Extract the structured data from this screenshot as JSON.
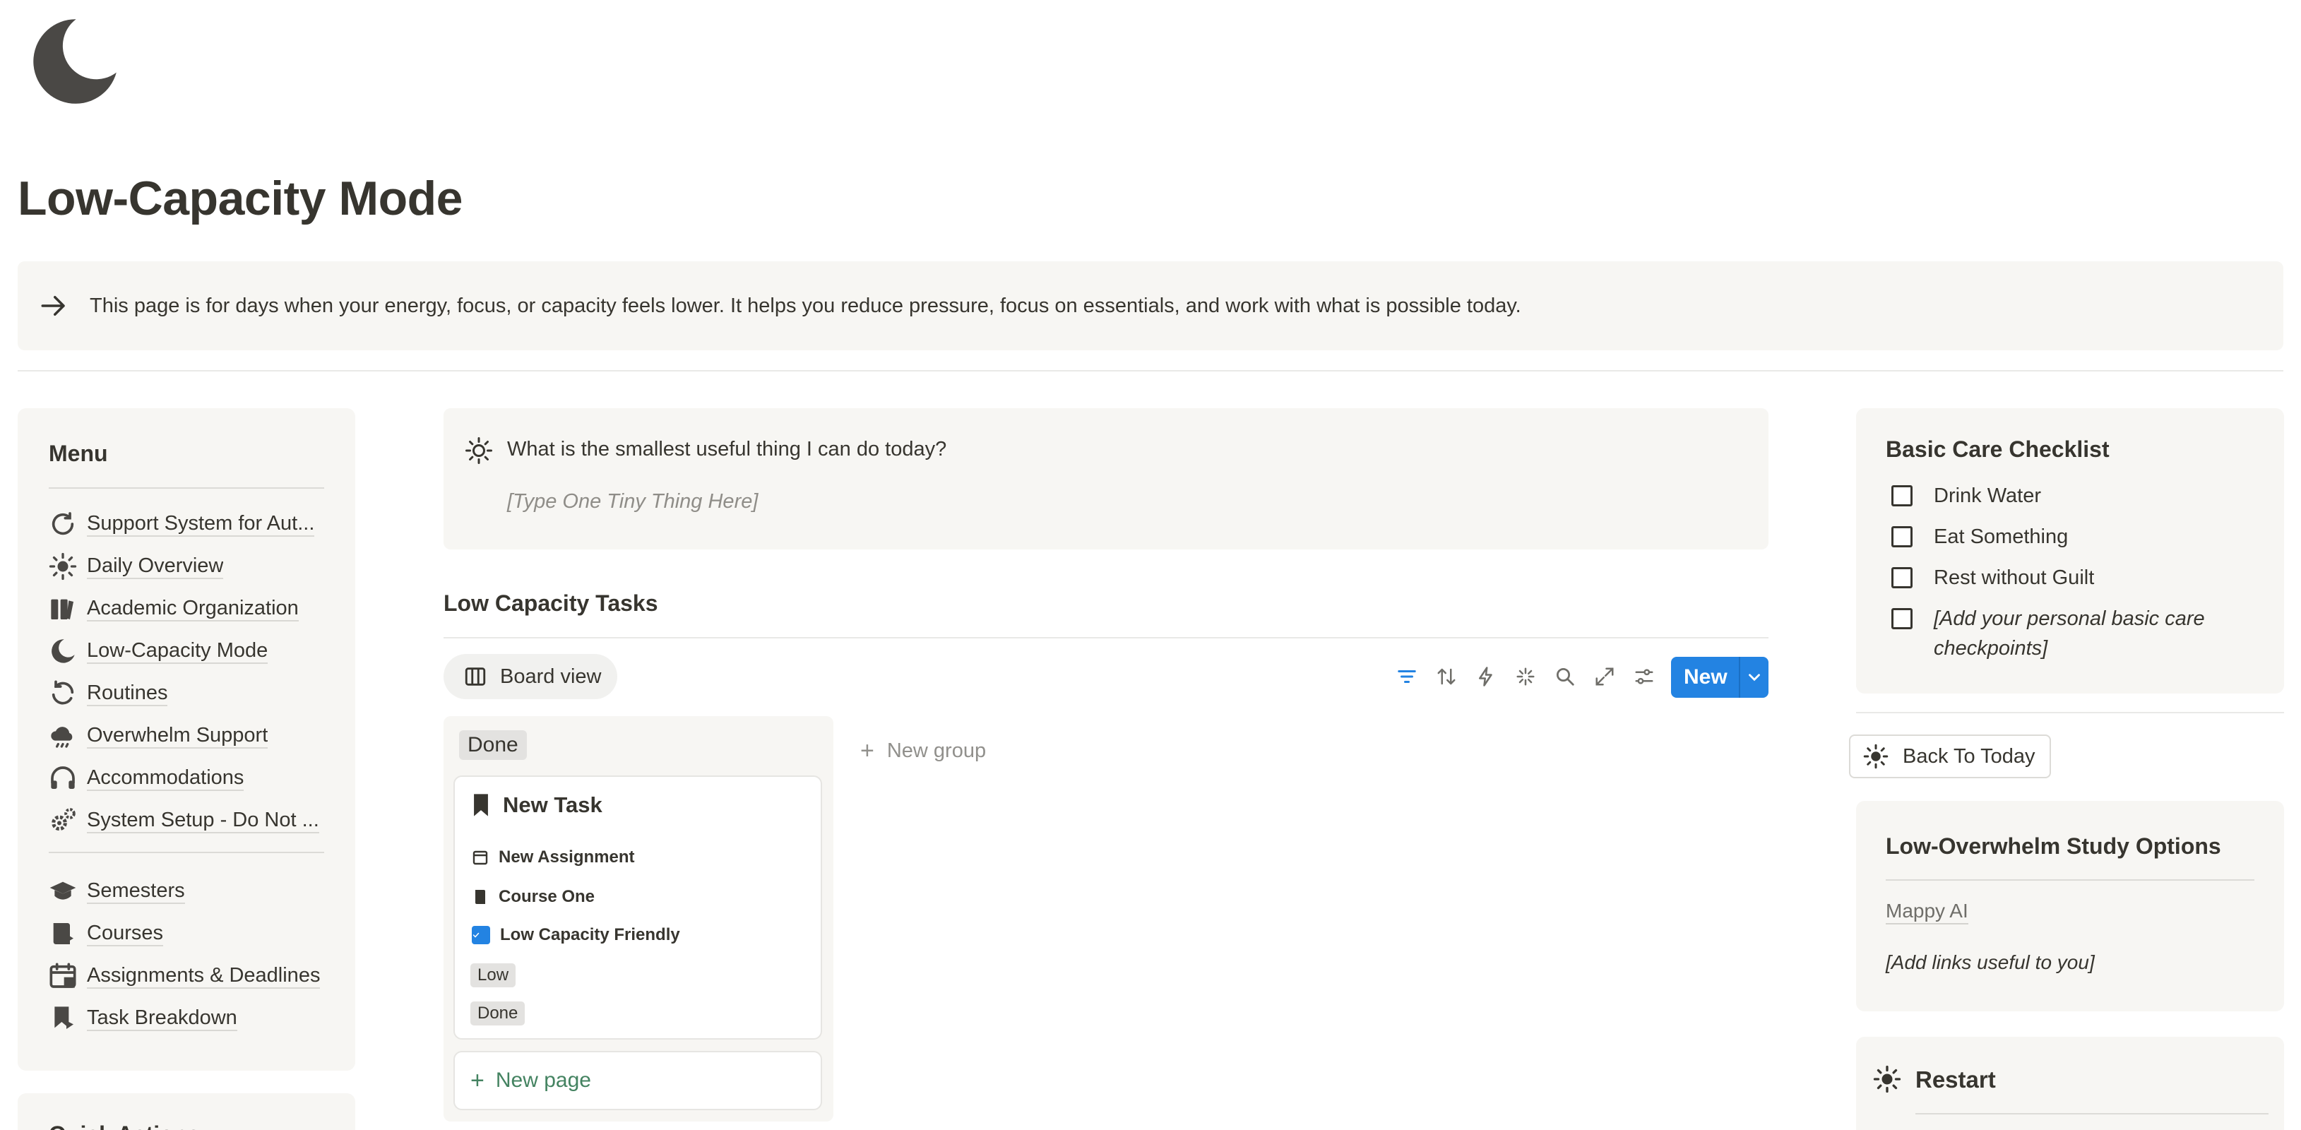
{
  "page": {
    "icon": "crescent-moon-icon",
    "title": "Low-Capacity Mode",
    "callout_icon": "arrow-right-icon",
    "callout_text": "This page is for days when your energy, focus, or capacity feels lower. It helps you reduce pressure, focus on essentials, and work with what is possible today."
  },
  "menu": {
    "title": "Menu",
    "items": [
      {
        "label": "Support System for Aut...",
        "icon": "refresh-icon"
      },
      {
        "label": "Daily Overview",
        "icon": "sun-icon"
      },
      {
        "label": "Academic Organization",
        "icon": "books-icon"
      },
      {
        "label": "Low-Capacity Mode",
        "icon": "moon-icon"
      },
      {
        "label": "Routines",
        "icon": "repeat-icon"
      },
      {
        "label": "Overwhelm Support",
        "icon": "cloud-rain-icon"
      },
      {
        "label": "Accommodations",
        "icon": "headphones-icon"
      },
      {
        "label": "System Setup - Do Not ...",
        "icon": "gears-icon"
      }
    ],
    "items2": [
      {
        "label": "Semesters",
        "icon": "graduation-cap-icon"
      },
      {
        "label": "Courses",
        "icon": "book-icon"
      },
      {
        "label": "Assignments & Deadlines",
        "icon": "calendar-icon"
      },
      {
        "label": "Task Breakdown",
        "icon": "bookmark-icon"
      }
    ],
    "next_card_title": "Quick Actions"
  },
  "prompt": {
    "icon": "sun-icon",
    "question": "What is the smallest useful thing I can do today?",
    "placeholder": "[Type One Tiny Thing Here]"
  },
  "tasks": {
    "title": "Low Capacity Tasks",
    "view_label": "Board view",
    "toolbar_icons": [
      "filter-icon",
      "sort-icon",
      "automation-icon",
      "sparkle-icon",
      "search-icon",
      "expand-icon",
      "settings-sliders-icon"
    ],
    "new_label": "New",
    "column": {
      "label": "Done",
      "card": {
        "title": "New Task",
        "assignment": "New Assignment",
        "course": "Course One",
        "checkbox_label": "Low Capacity Friendly",
        "checkbox_checked": true,
        "priority": "Low",
        "status": "Done"
      },
      "new_page_label": "New page"
    },
    "new_group_label": "New group"
  },
  "care": {
    "title": "Basic Care Checklist",
    "items": [
      "Drink Water",
      "Eat Something",
      "Rest without Guilt",
      "[Add your personal basic care checkpoints]"
    ]
  },
  "back_button_label": "Back To Today",
  "study": {
    "title": "Low-Overwhelm Study Options",
    "link": "Mappy AI",
    "placeholder": "[Add links useful to you]"
  },
  "restart": {
    "title": "Restart"
  },
  "colors": {
    "accent": "#2383e2",
    "card_bg": "#f7f6f3",
    "text": "#37352f",
    "green": "#448361"
  }
}
